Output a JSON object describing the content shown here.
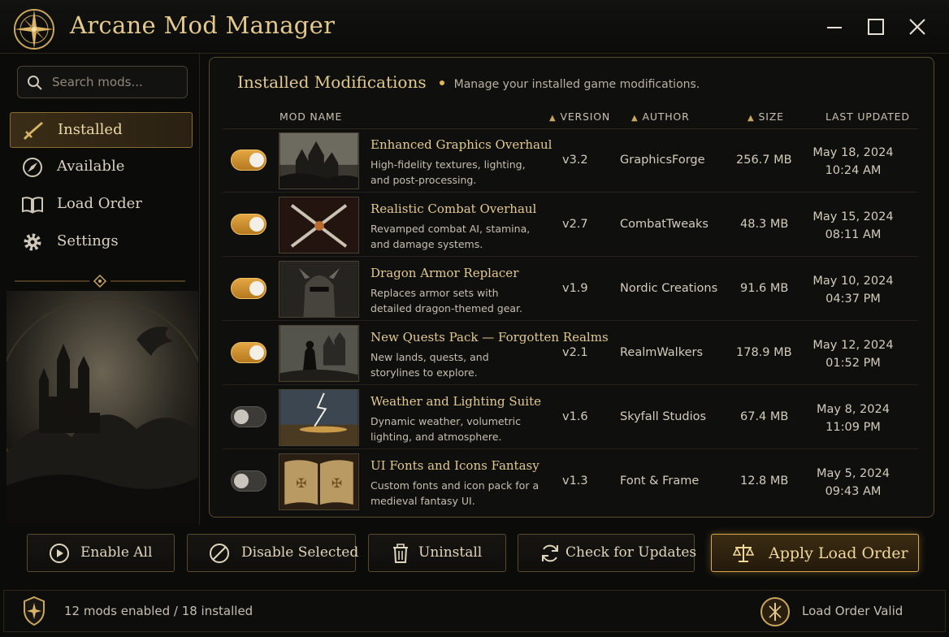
{
  "app": {
    "title": "Arcane Mod Manager"
  },
  "window_controls": [
    "minimize-icon",
    "maximize-icon",
    "close-icon"
  ],
  "sidebar": {
    "search": {
      "placeholder": "Search mods..."
    },
    "items": [
      {
        "label": "Installed",
        "icon": "sword-icon",
        "active": true
      },
      {
        "label": "Available",
        "icon": "compass-icon",
        "active": false
      },
      {
        "label": "Load Order",
        "icon": "book-icon",
        "active": false
      },
      {
        "label": "Settings",
        "icon": "gear-icon",
        "active": false
      }
    ]
  },
  "panel": {
    "title": "Installed Modifications",
    "subtitle": "Manage your installed game modifications."
  },
  "table": {
    "columns": [
      "MOD NAME",
      "VERSION",
      "AUTHOR",
      "SIZE",
      "LAST UPDATED"
    ],
    "rows": [
      {
        "enabled": true,
        "name": "Enhanced Graphics Overhaul",
        "description": "High-fidelity textures, lighting, and post-processing.",
        "version": "v3.2",
        "author": "GraphicsForge",
        "size": "256.7 MB",
        "date": "May 18, 2024",
        "time": "10:24 AM"
      },
      {
        "enabled": true,
        "name": "Realistic Combat Overhaul",
        "description": "Revamped combat AI, stamina, and damage systems.",
        "version": "v2.7",
        "author": "CombatTweaks",
        "size": "48.3 MB",
        "date": "May 15, 2024",
        "time": "08:11 AM"
      },
      {
        "enabled": true,
        "name": "Dragon Armor Replacer",
        "description": "Replaces armor sets with detailed dragon-themed gear.",
        "version": "v1.9",
        "author": "Nordic Creations",
        "size": "91.6 MB",
        "date": "May 10, 2024",
        "time": "04:37 PM"
      },
      {
        "enabled": true,
        "name": "New Quests Pack — Forgotten Realms",
        "description": "New lands, quests, and storylines to explore.",
        "version": "v2.1",
        "author": "RealmWalkers",
        "size": "178.9 MB",
        "date": "May 12, 2024",
        "time": "01:52 PM"
      },
      {
        "enabled": false,
        "name": "Weather and Lighting Suite",
        "description": "Dynamic weather, volumetric lighting, and atmosphere.",
        "version": "v1.6",
        "author": "Skyfall Studios",
        "size": "67.4 MB",
        "date": "May 8, 2024",
        "time": "11:09 PM"
      },
      {
        "enabled": false,
        "name": "UI Fonts and Icons Fantasy",
        "description": "Custom fonts and icon pack for a medieval fantasy UI.",
        "version": "v1.3",
        "author": "Font & Frame",
        "size": "12.8 MB",
        "date": "May 5, 2024",
        "time": "09:43 AM"
      }
    ]
  },
  "actions": {
    "enable_all": "Enable All",
    "disable_selected": "Disable Selected",
    "uninstall": "Uninstall",
    "check_updates": "Check for Updates",
    "apply_load_order": "Apply Load Order"
  },
  "status": {
    "left": "12 mods enabled / 18 installed",
    "right": "Load Order Valid"
  },
  "colors": {
    "accent": "#e3c98e",
    "toggle_on": "#d9982f",
    "background": "#0b0b0a"
  }
}
